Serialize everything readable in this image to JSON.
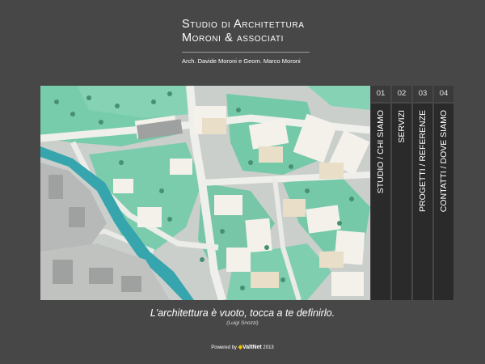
{
  "header": {
    "title_line1": "Studio di Architettura",
    "title_line2": "Moroni & associati",
    "subtitle": "Arch. Davide Moroni e Geom. Marco Moroni"
  },
  "nav": {
    "items": [
      {
        "number": "01",
        "label": "STUDIO / CHI SIAMO"
      },
      {
        "number": "02",
        "label": "SERVIZI"
      },
      {
        "number": "03",
        "label": "PROGETTI / REFERENZE"
      },
      {
        "number": "04",
        "label": "CONTATTI / DOVE SIAMO"
      }
    ]
  },
  "quote": {
    "text": "L'architettura è vuoto, tocca a te definirlo.",
    "author": "(Luigi Snozzi)"
  },
  "footer": {
    "powered_by": "Powered by",
    "brand": "ValtNet",
    "year": "2013"
  },
  "colors": {
    "background": "#474747",
    "nav_body": "#2a2a2a",
    "nav_number": "#3a3a3a",
    "model_green": "#6fc9a6",
    "river": "#2aa0a8"
  }
}
